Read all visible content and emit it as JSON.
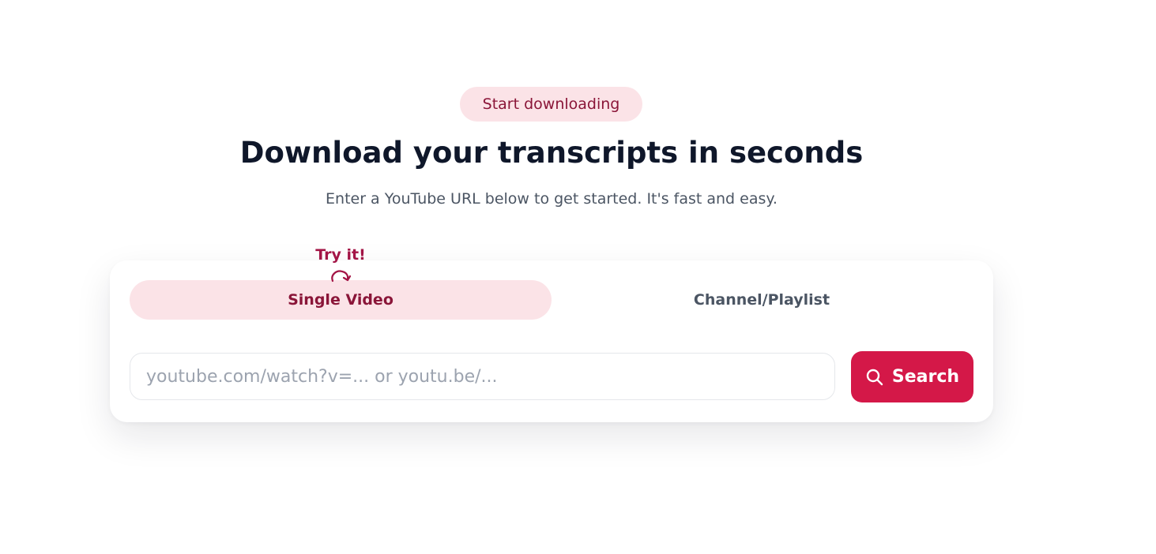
{
  "hero": {
    "badge": "Start downloading",
    "title": "Download your transcripts in seconds",
    "subtitle": "Enter a YouTube URL below to get started. It's fast and easy."
  },
  "card": {
    "try_it": "Try it!",
    "tabs": [
      {
        "label": "Single Video",
        "active": true
      },
      {
        "label": "Channel/Playlist",
        "active": false
      }
    ],
    "input": {
      "placeholder": "youtube.com/watch?v=... or youtu.be/...",
      "value": ""
    },
    "search_button": {
      "label": "Search",
      "icon": "search-icon"
    }
  },
  "colors": {
    "accent": "#d41848",
    "badge_bg": "#fbe3e7",
    "badge_text": "#8a1538",
    "title": "#0f172a",
    "subtitle": "#4b5563"
  }
}
